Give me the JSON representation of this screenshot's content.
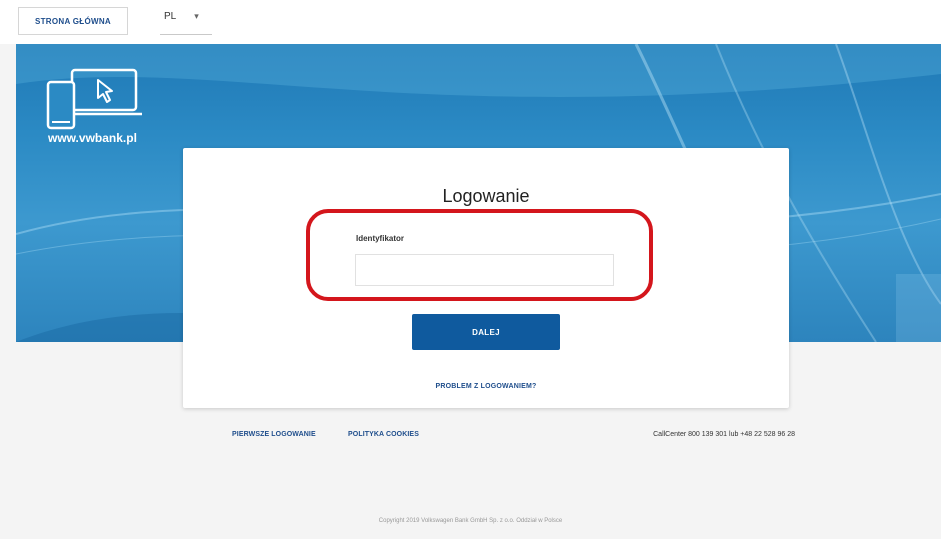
{
  "header": {
    "home_button_label": "STRONA GŁÓWNA",
    "language_value": "PL"
  },
  "banner": {
    "site_url": "www.vwbank.pl"
  },
  "login": {
    "title": "Logowanie",
    "identifier_label": "Identyfikator",
    "identifier_value": "",
    "next_button_label": "DALEJ",
    "problem_link_label": "PROBLEM Z LOGOWANIEM?"
  },
  "footer": {
    "first_login_label": "PIERWSZE LOGOWANIE",
    "cookies_label": "POLITYKA COOKIES",
    "call_center": "CallCenter 800 139 301 lub +48 22 528 96 28",
    "copyright": "Copyright 2019 Volkswagen Bank GmbH Sp. z o.o. Oddział w Polsce"
  },
  "colors": {
    "brand_blue": "#0f5a9e",
    "banner_blue": "#2b8ac4",
    "highlight_red": "#d4161c"
  }
}
